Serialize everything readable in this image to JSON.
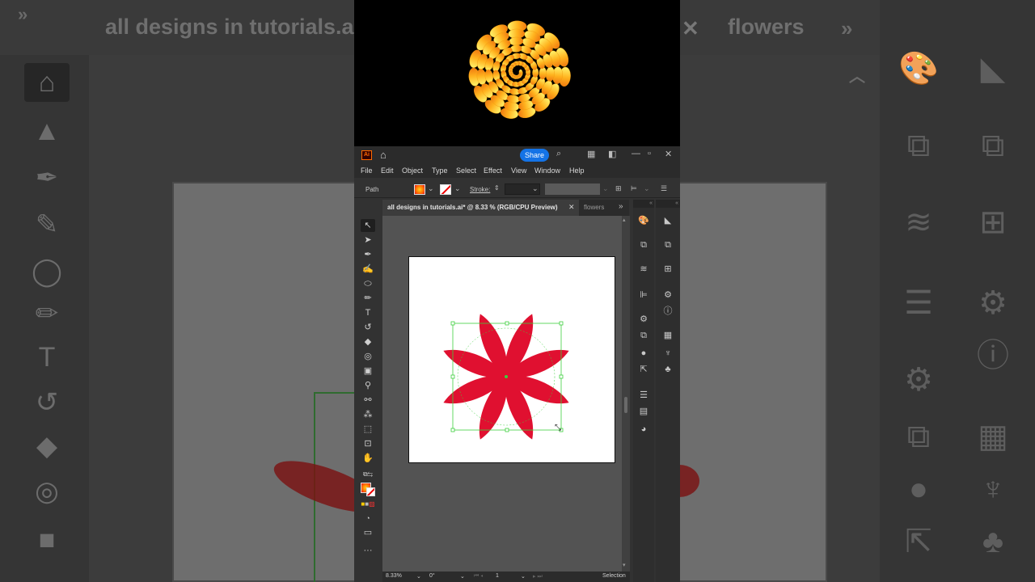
{
  "background": {
    "document_title": "all designs in tutorials.ai*",
    "secondary_tab": "flowers",
    "close_glyph": "✕"
  },
  "app": {
    "logo": "Ai",
    "share_label": "Share"
  },
  "menu": [
    "File",
    "Edit",
    "Object",
    "Type",
    "Select",
    "Effect",
    "View",
    "Window",
    "Help"
  ],
  "control_bar": {
    "selection_type": "Path",
    "stroke_label": "Stroke:"
  },
  "document_tab": {
    "title": "all designs in tutorials.ai* @ 8.33 % (RGB/CPU Preview)",
    "close_glyph": "✕",
    "secondary_tab": "flowers",
    "more_glyph": "»"
  },
  "status_bar": {
    "zoom": "8.33%",
    "rotation": "0°",
    "artboard_number": "1",
    "tool": "Selection"
  },
  "artwork": {
    "shape": "eight-petal flower",
    "petal_count": 8,
    "gradient_colors": [
      "#ffe11a",
      "#ff8c00",
      "#e01030"
    ],
    "selection_color": "#3ecf3e"
  },
  "preview": {
    "shape": "spiral flower",
    "gradient_colors": [
      "#fff36b",
      "#ffb21e",
      "#f07a10"
    ]
  },
  "icons": {
    "tools": [
      "selection-tool-icon",
      "direct-selection-tool-icon",
      "pen-tool-icon",
      "curvature-tool-icon",
      "ellipse-tool-icon",
      "pencil-tool-icon",
      "type-tool-icon",
      "rotate-tool-icon",
      "eraser-tool-icon",
      "shape-builder-tool-icon",
      "gradient-tool-icon",
      "eyedropper-tool-icon",
      "blend-tool-icon",
      "symbol-sprayer-tool-icon",
      "free-transform-tool-icon",
      "artboard-tool-icon",
      "hand-tool-icon",
      "more-tools-icon"
    ],
    "panels": [
      "color-panel-icon",
      "gradient-panel-icon",
      "layers-panel-icon",
      "align-panel-icon",
      "properties-panel-icon",
      "info-panel-icon",
      "pathfinder-panel-icon",
      "symbols-panel-icon"
    ]
  }
}
